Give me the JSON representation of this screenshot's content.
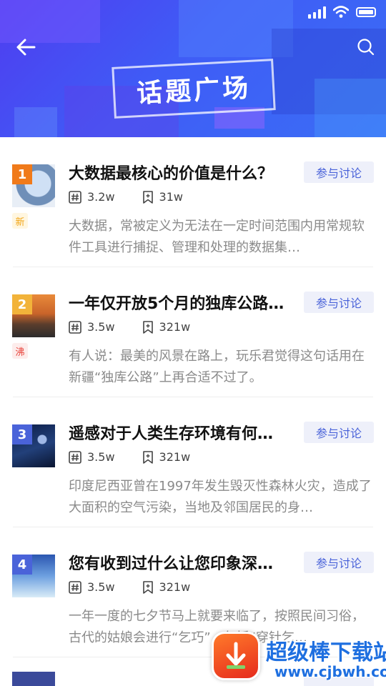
{
  "header": {
    "title": "话题广场",
    "back_icon": "arrow-left-icon",
    "search_icon": "search-icon"
  },
  "status_bar": {
    "signal_icon": "signal-icon",
    "wifi_icon": "wifi-icon",
    "battery_icon": "battery-icon"
  },
  "topics": [
    {
      "rank": "1",
      "rank_color": "#f07a1a",
      "tag": "新",
      "tag_color": "#f2a516",
      "tag_bg": "#fff6e0",
      "title": "大数据最核心的价值是什么？",
      "join_label": "参与讨论",
      "discussions": "3.2w",
      "follows": "31w",
      "desc": "大数据，常被定义为无法在一定时间范围内用常规软件工具进行捕捉、管理和处理的数据集…"
    },
    {
      "rank": "2",
      "rank_color": "#f2b33a",
      "tag": "沸",
      "tag_color": "#e8453c",
      "tag_bg": "#fdeceb",
      "title": "一年仅开放5个月的独库公路…",
      "join_label": "参与讨论",
      "discussions": "3.5w",
      "follows": "321w",
      "desc": "有人说：最美的风景在路上，玩乐君觉得这句话用在新疆“独库公路”上再合适不过了。"
    },
    {
      "rank": "3",
      "rank_color": "#4a63d9",
      "tag": "",
      "title": "遥感对于人类生存环境有何…",
      "join_label": "参与讨论",
      "discussions": "3.5w",
      "follows": "321w",
      "desc": "印度尼西亚曾在1997年发生毁灭性森林火灾，造成了大面积的空气污染，当地及邻国居民的身…"
    },
    {
      "rank": "4",
      "rank_color": "#4a63d9",
      "tag": "",
      "title": "您有收到过什么让您印象深…",
      "join_label": "参与讨论",
      "discussions": "3.5w",
      "follows": "321w",
      "desc": "一年一度的七夕节马上就要来临了，按照民间习俗，古代的姑娘会进行“乞巧”，包括“穿针乞…"
    }
  ],
  "watermark": {
    "title": "超级棒下载站",
    "url": "www.cjbwh.com"
  }
}
